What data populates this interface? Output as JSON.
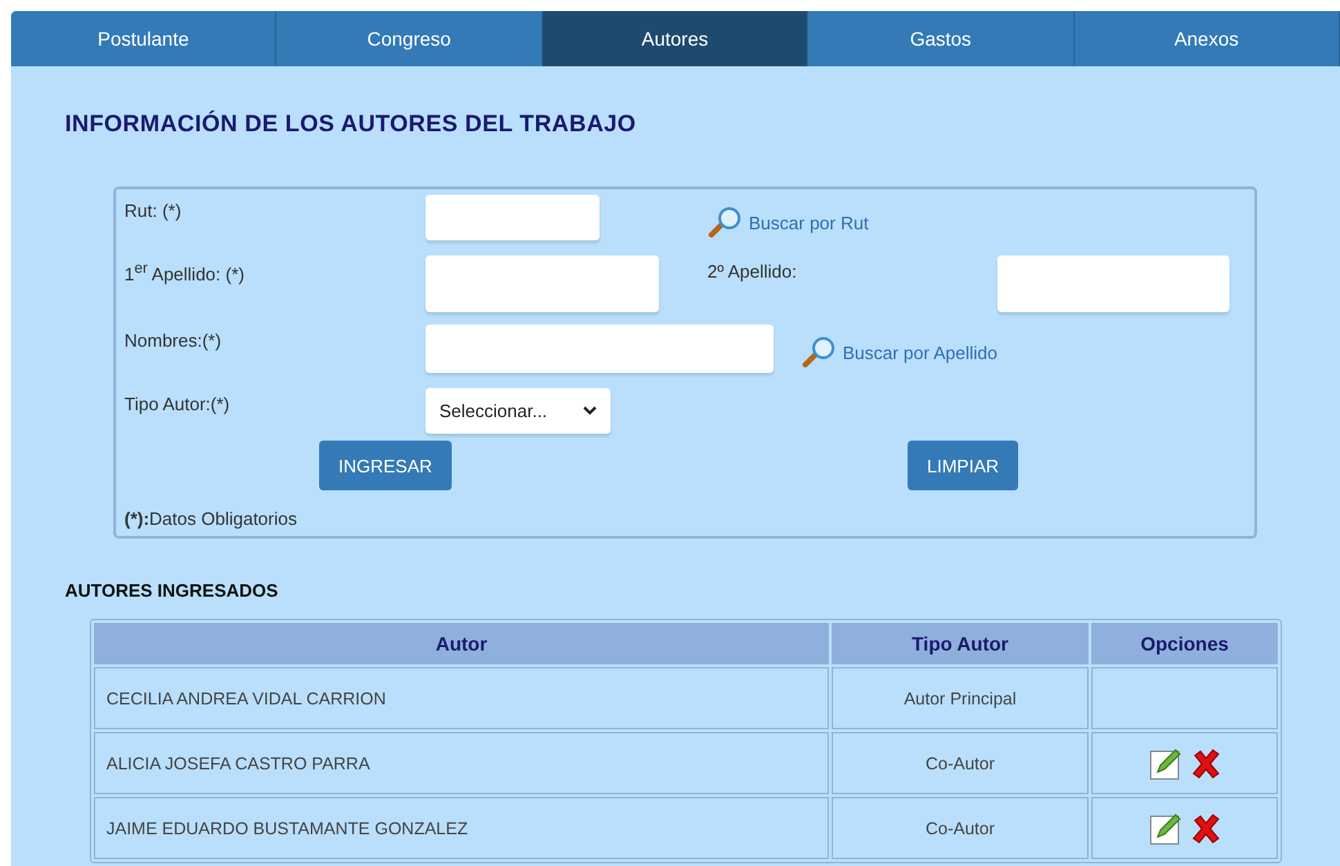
{
  "tabs": [
    {
      "label": "Postulante",
      "selected": false
    },
    {
      "label": "Congreso",
      "selected": false
    },
    {
      "label": "Autores",
      "selected": true
    },
    {
      "label": "Gastos",
      "selected": false
    },
    {
      "label": "Anexos",
      "selected": false
    }
  ],
  "title": "INFORMACIÓN DE LOS AUTORES DEL TRABAJO",
  "form": {
    "rut_label": "Rut: (*)",
    "search_rut": "Buscar por Rut",
    "apellido1_label": "1$^{er}$ Apellido: (*)",
    "apellido2_label": "2º Apellido:",
    "nombres_label": "Nombres:(*)",
    "search_apellido": "Buscar por Apellido",
    "tipo_label": "Tipo Autor:(*)",
    "tipo_value": "Seleccionar...",
    "buttons": [
      "INGRESAR",
      "LIMPIAR"
    ],
    "note": "**(*):**Datos Obligatorios"
  },
  "table": {
    "heading": "AUTORES INGRESADOS",
    "columns": [
      "Autor",
      "Tipo Autor",
      "Opciones"
    ],
    "rows": [
      {
        "autor": "CECILIA ANDREA VIDAL CARRION",
        "tipo": "Autor Principal",
        "actions": []
      },
      {
        "autor": "ALICIA JOSEFA CASTRO PARRA",
        "tipo": "Co-Autor",
        "actions": [
          {
            "kind": "edit"
          },
          {
            "kind": "delete"
          }
        ]
      },
      {
        "autor": "JAIME EDUARDO BUSTAMANTE GONZALEZ",
        "tipo": "Co-Autor",
        "actions": [
          {
            "kind": "edit"
          },
          {
            "kind": "delete"
          }
        ]
      }
    ]
  }
}
